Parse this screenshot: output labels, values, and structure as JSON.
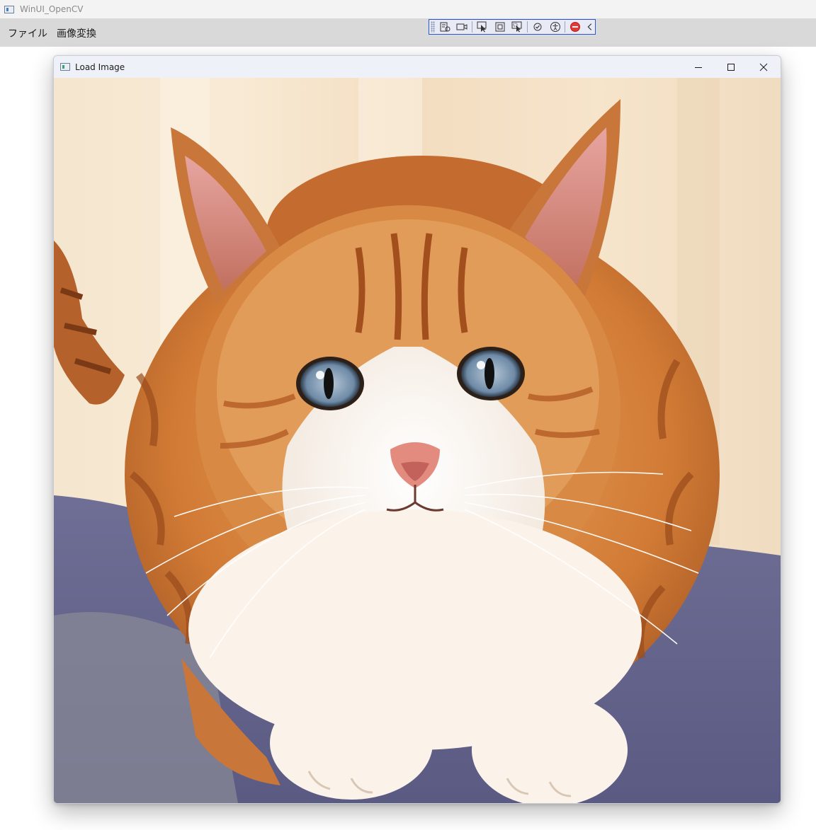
{
  "app": {
    "title": "WinUI_OpenCV"
  },
  "menu": {
    "file": "ファイル",
    "image_transform": "画像変換"
  },
  "debug_toolbar": {
    "buttons": [
      "live-visual-tree-icon",
      "record-icon",
      "select-element-icon",
      "display-layout-adorners-icon",
      "track-focus-icon",
      "hot-reload-icon",
      "accessibility-icon",
      "stop-icon",
      "collapse-chevron-icon"
    ],
    "stop_color": "#e53935",
    "border_color": "#2b57c9"
  },
  "child_window": {
    "title": "Load Image",
    "image": "ginger-tabby-cat-photo"
  }
}
